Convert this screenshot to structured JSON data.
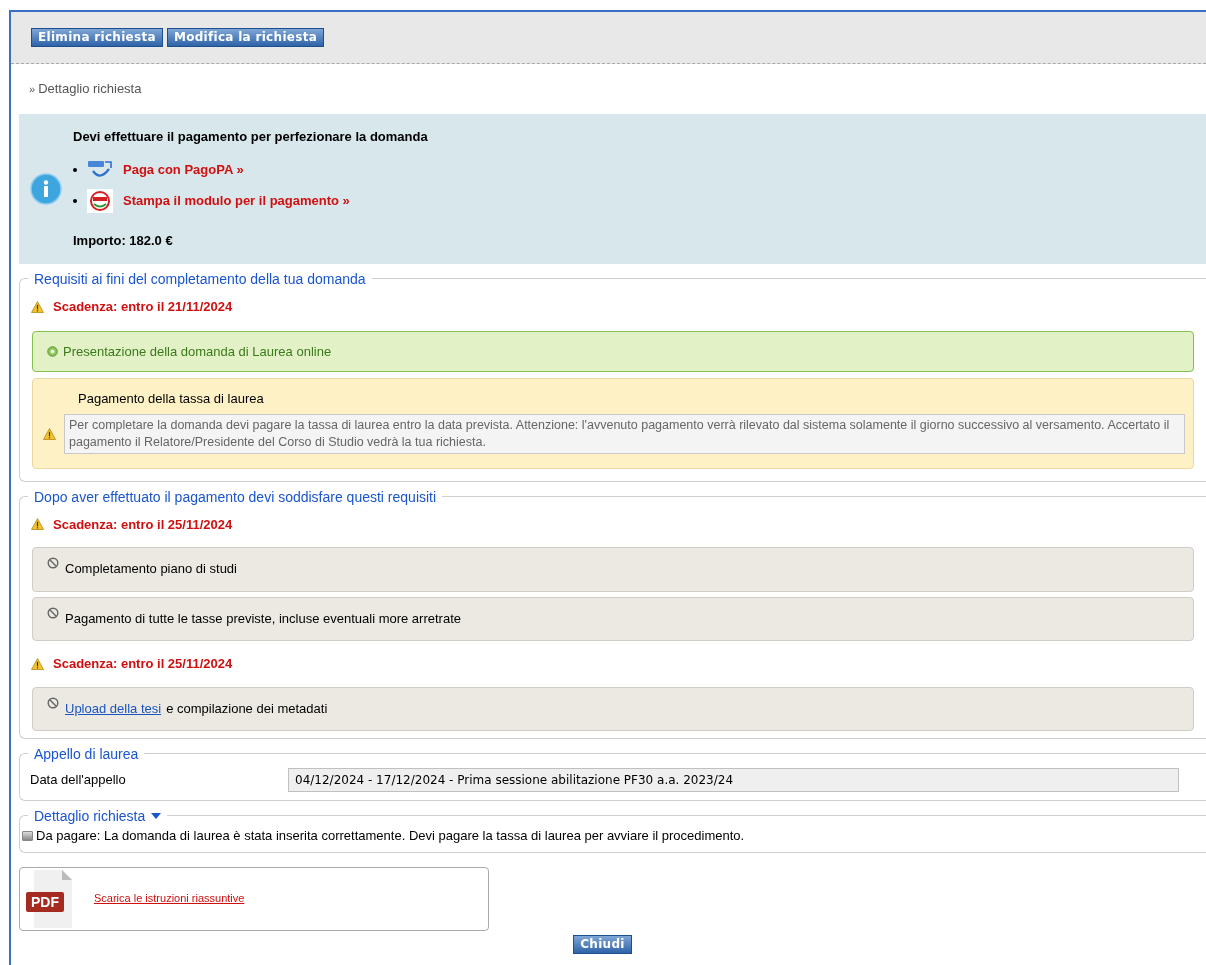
{
  "toolbar": {
    "buttons": [
      "Elimina richiesta",
      "Modifica la richiesta"
    ]
  },
  "breadcrumb": {
    "marker": "»",
    "text": "Dettaglio richiesta"
  },
  "payment_notice": {
    "title": "Devi effettuare il pagamento per perfezionare la domanda",
    "links": [
      {
        "kind": "pagopa",
        "text": "Paga con PagoPA »"
      },
      {
        "kind": "print",
        "text": "Stampa il modulo per il pagamento »"
      }
    ],
    "amount": "Importo: 182.0 €"
  },
  "sections": [
    {
      "title": "Requisiti ai fini del completamento della tua domanda",
      "items": [
        {
          "kind": "deadline",
          "text": "Scadenza: entro il 21/11/2024"
        },
        {
          "kind": "done",
          "text": "Presentazione della domanda di Laurea online"
        },
        {
          "kind": "warning",
          "title": "Pagamento della tassa di laurea",
          "text": "Per completare la domanda devi pagare la tassa di laurea entro la data prevista. Attenzione: l'avvenuto pagamento verrà rilevato dal sistema solamente il giorno successivo al versamento. Accertato il pagamento il Relatore/Presidente del Corso di Studio vedrà la tua richiesta."
        }
      ]
    },
    {
      "title": "Dopo aver effettuato il pagamento devi soddisfare questi requisiti",
      "items": [
        {
          "kind": "deadline",
          "text": "Scadenza: entro il 25/11/2024"
        },
        {
          "kind": "todo",
          "text": "Completamento piano di studi"
        },
        {
          "kind": "todo",
          "text": "Pagamento di tutte le tasse previste, incluse eventuali more arretrate"
        },
        {
          "kind": "deadline",
          "text": "Scadenza: entro il 25/11/2024"
        },
        {
          "kind": "todo",
          "link": "Upload della tesi",
          "text": "e compilazione dei metadati"
        }
      ]
    }
  ],
  "appello": {
    "title": "Appello di laurea",
    "label": "Data dell'appello",
    "value": "04/12/2024 - 17/12/2024 - Prima sessione abilitazione PF30 a.a. 2023/24"
  },
  "detail": {
    "title": "Dettaglio richiesta",
    "expanded": true,
    "status": "Da pagare: La domanda di laurea è stata inserita correttamente. Devi pagare la tassa di laurea per avviare il procedimento."
  },
  "attachment": {
    "badge": "PDF",
    "link": "Scarica le istruzioni riassuntive"
  },
  "close_button": "Chiudi"
}
